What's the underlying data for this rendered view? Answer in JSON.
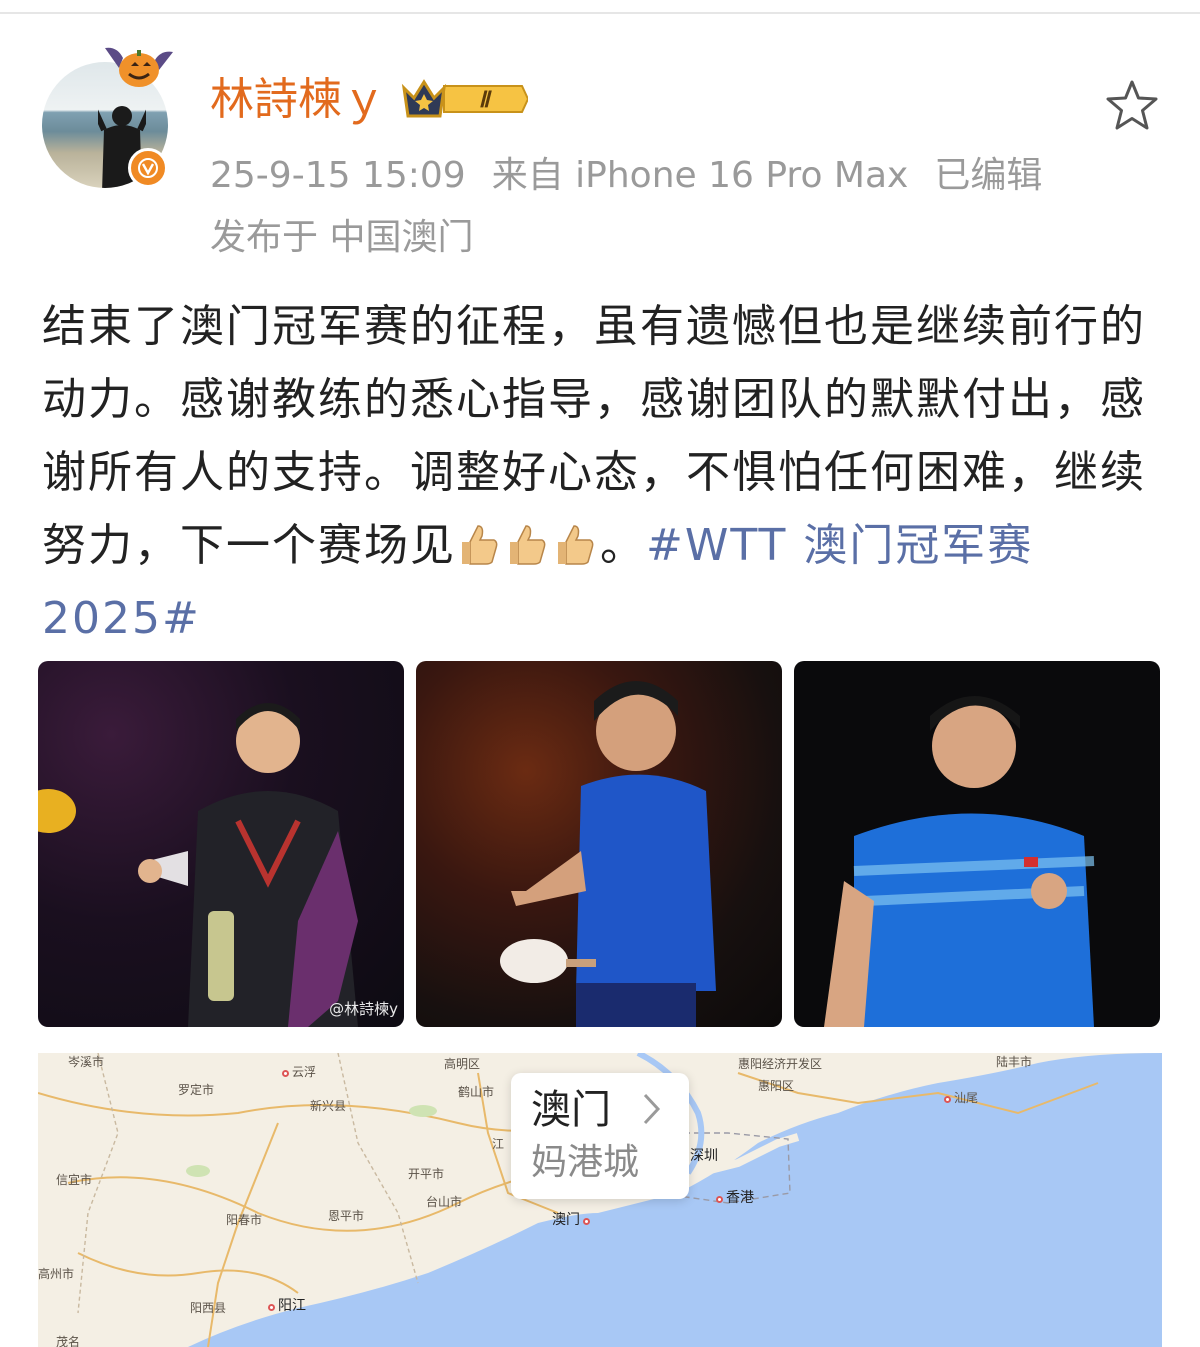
{
  "post": {
    "username": "林詩楝ｙ",
    "rank_badge": "Ⅱ",
    "verified_icon": "verified-v-icon",
    "time": "25-9-15 15:09",
    "source": "来自 iPhone 16 Pro Max",
    "edited": "已编辑",
    "location": "发布于 中国澳门",
    "text_main": "结束了澳门冠军赛的征程，虽有遗憾但也是继续前行的动力。感谢教练的悉心指导，感谢团队的默默付出，感谢所有人的支持。调整好心态，不惧怕任何困难，继续努力，下一个赛场见",
    "emoji_icon": "thumbs-up-icon",
    "text_tail": "。",
    "hashtag": "#WTT 澳门冠军赛2025#",
    "photo_watermark": "@林詩楝y"
  },
  "map": {
    "card_title": "澳门",
    "card_subtitle": "妈港城",
    "labels": {
      "yunfu": "云浮",
      "luoding": "罗定市",
      "xinxing": "新兴县",
      "xinyi": "信宜市",
      "yangchun": "阳春市",
      "enping": "恩平市",
      "kaiping": "开平市",
      "taishan": "台山市",
      "gaozhou": "高州市",
      "yangxi": "阳西县",
      "yangjiang": "阳江",
      "jiangmen": "江",
      "heshan": "鹤山市",
      "gaoming": "高明区",
      "macau": "澳门",
      "shenzhen": "深圳",
      "hongkong": "香港",
      "huiyang": "惠阳区",
      "huiyang_dev": "惠阳经济开发区",
      "lufeng": "陆丰市",
      "shanwei": "汕尾",
      "maoming": "茂名",
      "cenxi": "岑溪市"
    }
  }
}
